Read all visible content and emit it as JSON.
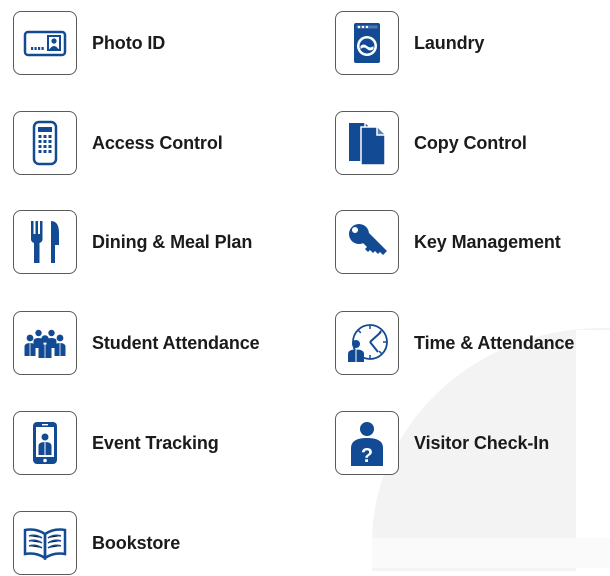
{
  "theme": {
    "icon_color": "#124a93",
    "border_color": "#5b5b5b"
  },
  "services": [
    {
      "label": "Photo ID",
      "icon": "photo-id-card-icon"
    },
    {
      "label": "Laundry",
      "icon": "washing-machine-icon"
    },
    {
      "label": "Access Control",
      "icon": "keypad-reader-icon"
    },
    {
      "label": "Copy Control",
      "icon": "documents-icon"
    },
    {
      "label": "Dining & Meal Plan",
      "icon": "fork-knife-icon"
    },
    {
      "label": "Key Management",
      "icon": "key-icon"
    },
    {
      "label": "Student Attendance",
      "icon": "student-group-icon"
    },
    {
      "label": "Time & Attendance",
      "icon": "person-clock-icon"
    },
    {
      "label": "Event Tracking",
      "icon": "phone-person-icon"
    },
    {
      "label": "Visitor Check-In",
      "icon": "visitor-question-icon"
    },
    {
      "label": "Bookstore",
      "icon": "open-book-icon"
    }
  ]
}
